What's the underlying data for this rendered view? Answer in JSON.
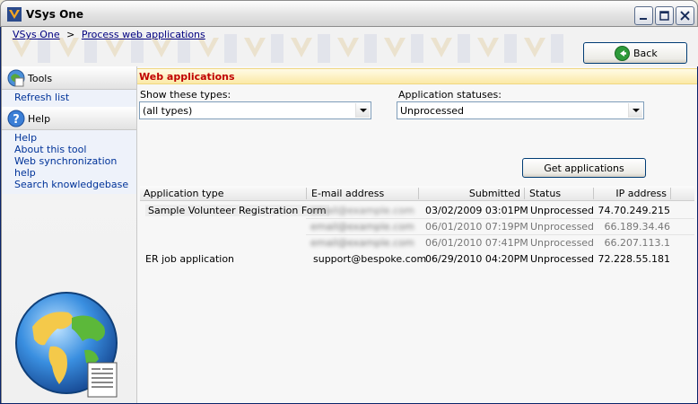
{
  "window": {
    "title": "VSys One"
  },
  "breadcrumb": {
    "root": "VSys One",
    "separator": ">",
    "current": "Process web applications"
  },
  "back_button": {
    "label": "Back"
  },
  "sidebar": {
    "tools": {
      "title": "Tools",
      "items": [
        {
          "label": "Refresh list"
        }
      ]
    },
    "help": {
      "title": "Help",
      "items": [
        {
          "label": "Help"
        },
        {
          "label": "About this tool"
        },
        {
          "label": "Web synchronization help"
        },
        {
          "label": "Search knowledgebase"
        }
      ]
    }
  },
  "content": {
    "title": "Web applications",
    "types_label": "Show these types:",
    "types_value": "(all types)",
    "statuses_label": "Application statuses:",
    "statuses_value": "Unprocessed",
    "get_button": "Get applications"
  },
  "grid": {
    "columns": [
      "Application type",
      "E-mail address",
      "Submitted",
      "Status",
      "IP address"
    ],
    "rows": [
      {
        "type": "Sample Volunteer Registration Form",
        "email": "email@example.com",
        "submitted": "03/02/2009 03:01PM",
        "status": "Unprocessed",
        "ip": "74.70.249.215"
      },
      {
        "type": "",
        "email": "email@example.com",
        "submitted": "06/01/2010 07:19PM",
        "status": "Unprocessed",
        "ip": "66.189.34.46"
      },
      {
        "type": "",
        "email": "email@example.com",
        "submitted": "06/01/2010 07:41PM",
        "status": "Unprocessed",
        "ip": "66.207.113.1"
      },
      {
        "type": "ER job application",
        "email": "support@bespoke.com",
        "submitted": "06/29/2010 04:20PM",
        "status": "Unprocessed",
        "ip": "72.228.55.181"
      }
    ]
  },
  "colors": {
    "title_text": "#c00000",
    "link": "#003399",
    "header_band": "#fbe9a6"
  }
}
